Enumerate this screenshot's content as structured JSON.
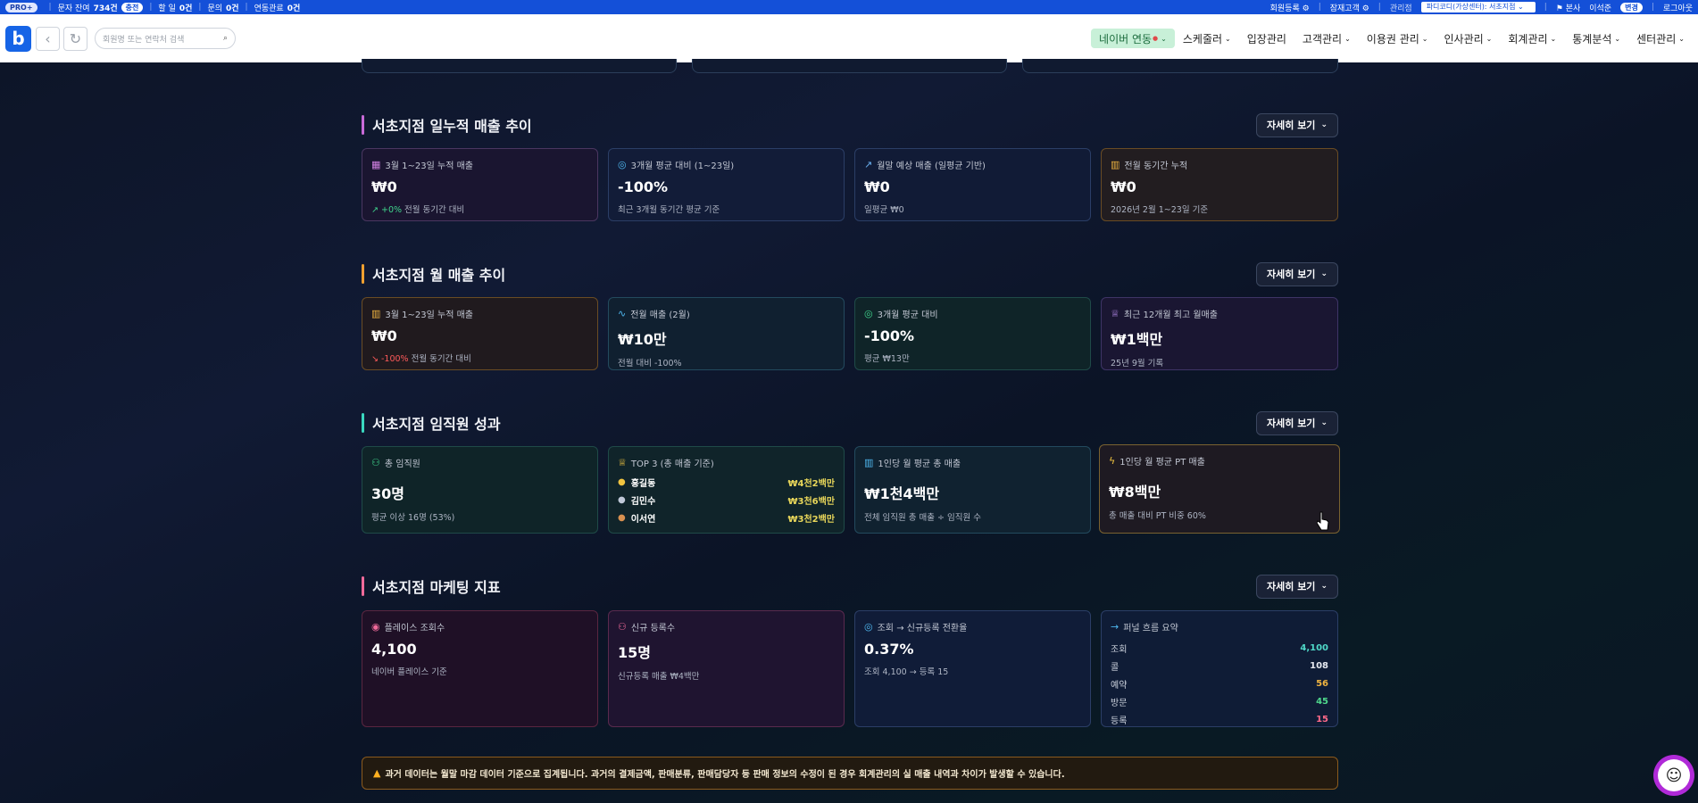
{
  "topbar": {
    "pro_badge": "PRO+",
    "sms_label": "문자 잔여",
    "sms_value": "734건",
    "sms_chip": "충전",
    "todo_label": "할 일",
    "todo_value": "0건",
    "inquiry_label": "문의",
    "inquiry_value": "0건",
    "contact_label": "연동관료",
    "contact_value": "0건",
    "register_link": "회원등록",
    "prospect_link": "잠재고객",
    "manage_label": "관리점",
    "branch_select": "파디코디(가상센터): 서초지점",
    "hq_label": "본사",
    "user_name": "이석준",
    "change_chip": "변경",
    "logout": "로그아웃"
  },
  "nav": {
    "logo": "b",
    "search_placeholder": "회원명 또는 연락처 검색",
    "menu": [
      {
        "label": "네이버 연동",
        "active": true
      },
      {
        "label": "스케줄러"
      },
      {
        "label": "입장관리"
      },
      {
        "label": "고객관리"
      },
      {
        "label": "이용권 관리"
      },
      {
        "label": "인사관리"
      },
      {
        "label": "회계관리"
      },
      {
        "label": "통계분석"
      },
      {
        "label": "센터관리"
      }
    ]
  },
  "detail_label": "자세히 보기",
  "sections": {
    "daily": {
      "title": "서초지점 일누적 매출 추이",
      "cards": [
        {
          "icon": "calendar-icon",
          "label": "3월 1~23일 누적 매출",
          "value": "₩0",
          "trend": "+0%",
          "sub": "전월 동기간 대비"
        },
        {
          "icon": "target-icon",
          "label": "3개월 평균 대비 (1~23일)",
          "value": "-100%",
          "sub": "최근 3개월 동기간 평균 기준"
        },
        {
          "icon": "trend-up-icon",
          "label": "월말 예상 매출 (일평균 기반)",
          "value": "₩0",
          "sub": "일평균 ₩0"
        },
        {
          "icon": "bar-chart-icon",
          "label": "전월 동기간 누적",
          "value": "₩0",
          "sub": "2026년 2월 1~23일 기준"
        }
      ]
    },
    "monthly": {
      "title": "서초지점 월 매출 추이",
      "cards": [
        {
          "icon": "bar-chart-icon",
          "label": "3월 1~23일 누적 매출",
          "value": "₩0",
          "trend": "-100%",
          "sub": "전월 동기간 대비"
        },
        {
          "icon": "wave-icon",
          "label": "전월 매출 (2월)",
          "value": "₩10만",
          "sub": "전월 대비 -100%"
        },
        {
          "icon": "target-icon",
          "label": "3개월 평균 대비",
          "value": "-100%",
          "sub": "평균 ₩13만"
        },
        {
          "icon": "trophy-icon",
          "label": "최근 12개월 최고 월매출",
          "value": "₩1백만",
          "sub": "25년 9월 기록"
        }
      ]
    },
    "staff": {
      "title": "서초지점 임직원 성과",
      "cards": [
        {
          "icon": "users-icon",
          "label": "총 임직원",
          "value": "30명",
          "sub": "평균 이상 16명 (53%)"
        },
        {
          "icon": "trophy-icon",
          "label": "TOP 3 (총 매출 기준)",
          "top3": [
            {
              "name": "홍길동",
              "amount": "₩4천2백만"
            },
            {
              "name": "김민수",
              "amount": "₩3천6백만"
            },
            {
              "name": "이서연",
              "amount": "₩3천2백만"
            }
          ]
        },
        {
          "icon": "bar-chart-icon",
          "label": "1인당 월 평균 총 매출",
          "value": "₩1천4백만",
          "sub": "전체 임직원 총 매출 ÷ 임직원 수"
        },
        {
          "icon": "lightning-icon",
          "label": "1인당 월 평균 PT 매출",
          "value": "₩8백만",
          "sub": "총 매출 대비 PT 비중 60%"
        }
      ]
    },
    "marketing": {
      "title": "서초지점 마케팅 지표",
      "cards": [
        {
          "icon": "eye-icon",
          "label": "플레이스 조회수",
          "value": "4,100",
          "sub": "네이버 플레이스 기준"
        },
        {
          "icon": "user-plus-icon",
          "label": "신규 등록수",
          "value": "15명",
          "sub": "신규등록 매출 ₩4백만"
        },
        {
          "icon": "target-icon",
          "label": "조회 → 신규등록 전환율",
          "value": "0.37%",
          "sub": "조회 4,100 → 등록 15"
        },
        {
          "icon": "arrow-right-icon",
          "label": "퍼널 흐름 요약",
          "funnel": [
            {
              "name": "조회",
              "value": "4,100",
              "color": "#4fd8c8"
            },
            {
              "name": "콜",
              "value": "108",
              "color": "#e6e9f0"
            },
            {
              "name": "예약",
              "value": "56",
              "color": "#f0b440"
            },
            {
              "name": "방문",
              "value": "45",
              "color": "#4fd88c"
            },
            {
              "name": "등록",
              "value": "15",
              "color": "#ff6a8a"
            }
          ]
        }
      ]
    }
  },
  "notice": "과거 데이터는 월말 마감 데이터 기준으로 집계됩니다. 과거의 결제금액, 판매분류, 판매담당자 등 판매 정보의 수정이 된 경우 회계관리의 실 매출 내역과 차이가 발생할 수 있습니다.",
  "colors": {
    "daily_bar": "#c86ad8",
    "monthly_bar": "#f0a030",
    "staff_bar": "#3ad8c0",
    "marketing_bar": "#f06a9a"
  }
}
